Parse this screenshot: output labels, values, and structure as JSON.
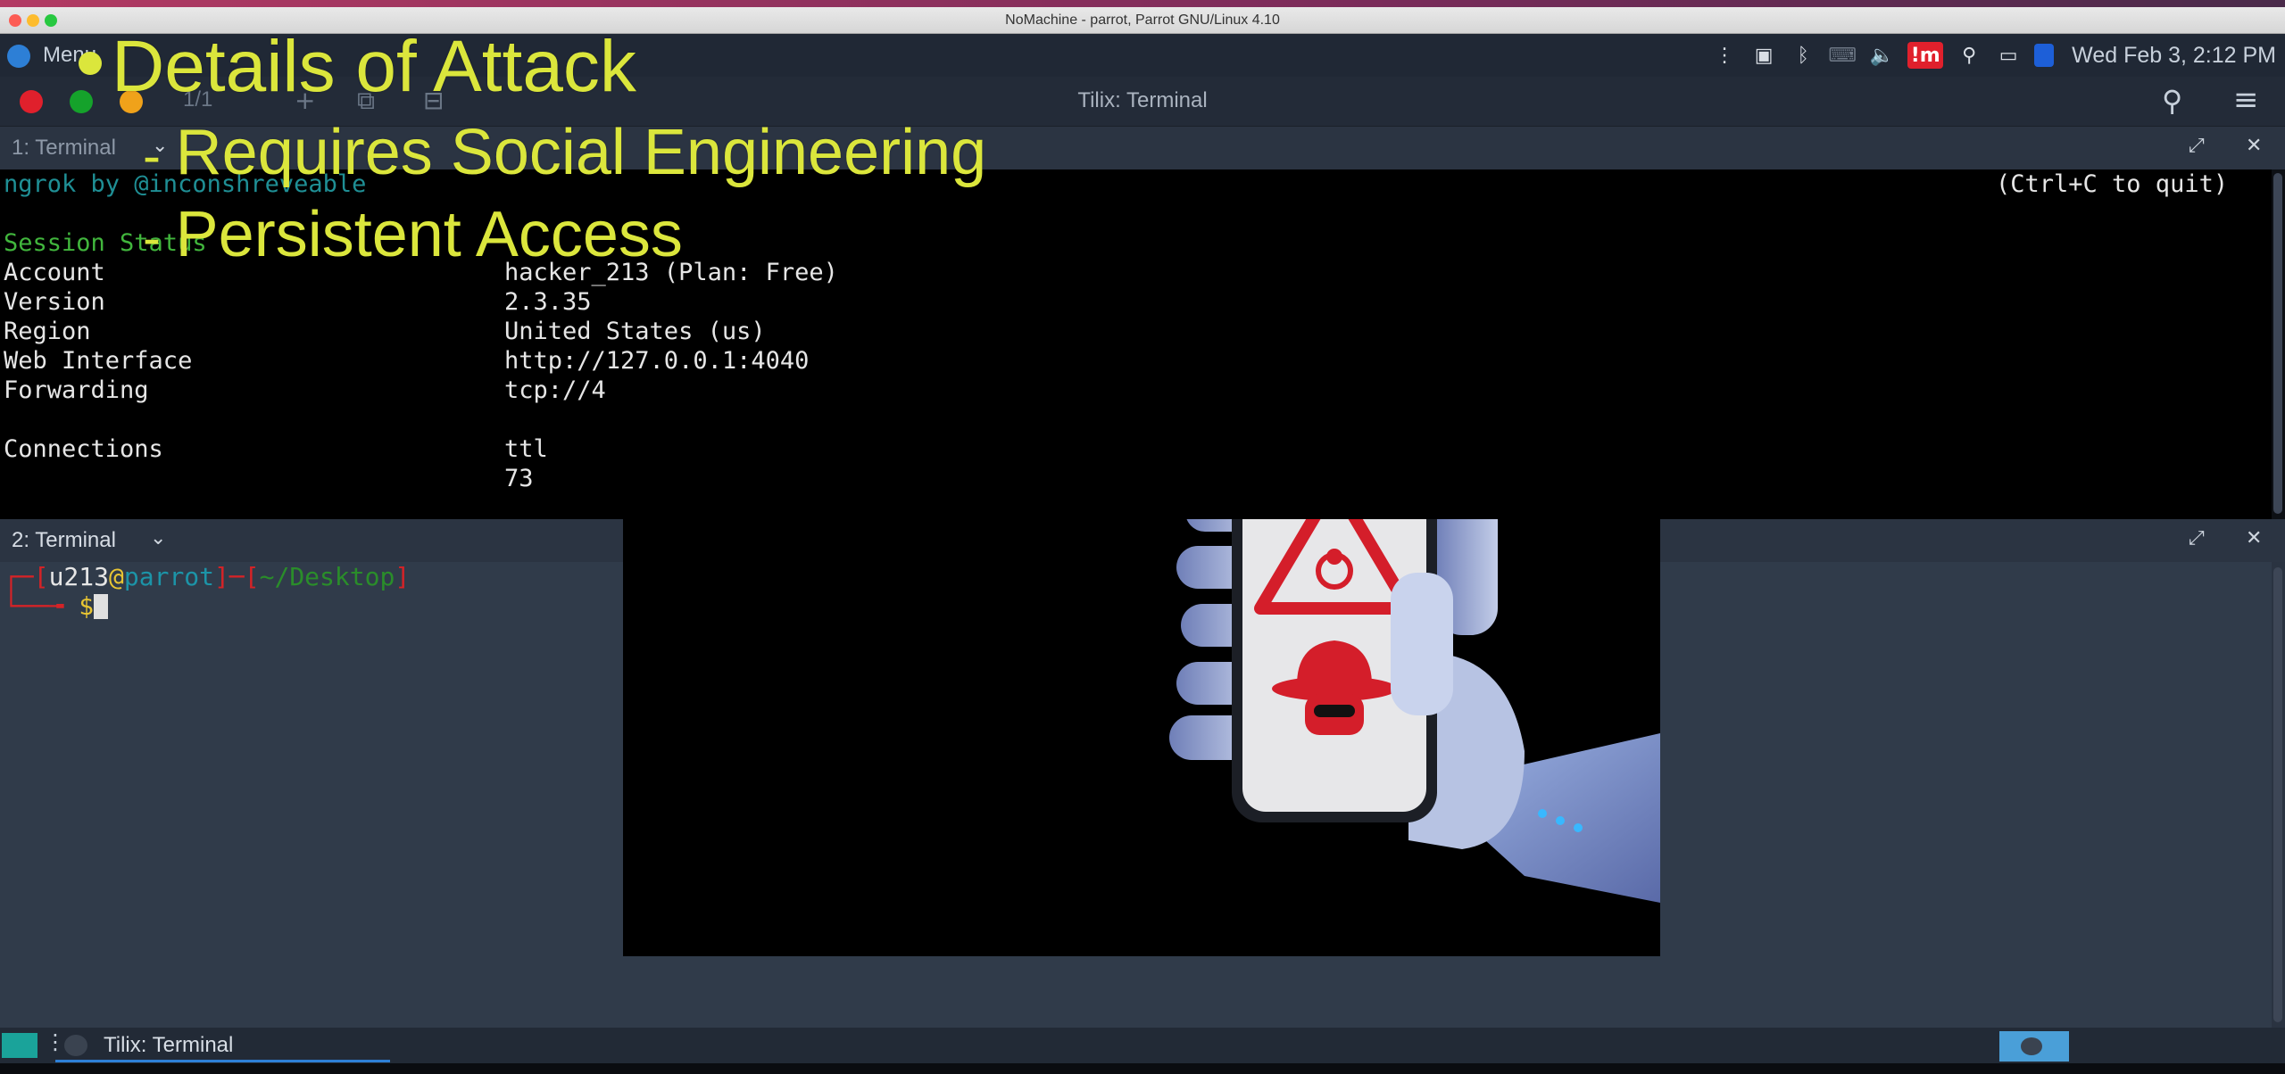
{
  "window": {
    "title": "NoMachine - parrot, Parrot GNU/Linux 4.10"
  },
  "panel": {
    "menu_label": "Menu",
    "clock": "Wed Feb 3,  2:12 PM",
    "tray_icons": [
      "more-vert-icon",
      "screenshot-icon",
      "bluetooth-icon",
      "keyboard-icon",
      "volume-icon",
      "im-icon",
      "bulb-icon",
      "display-icon",
      "shield-icon"
    ],
    "colors": {
      "accent_red": "#e0202c",
      "accent_blue": "#1d5fd8"
    }
  },
  "tilix": {
    "title": "Tilix: Terminal",
    "session_label": "1/1"
  },
  "terminal1": {
    "header_label": "1: Terminal",
    "header_line": "ngrok by @inconshreveable",
    "quit_hint": "(Ctrl+C to quit)",
    "status_heading": "Session Status",
    "rows": [
      {
        "key": "Account",
        "value": "hacker_213 (Plan: Free)"
      },
      {
        "key": "Version",
        "value": "2.3.35"
      },
      {
        "key": "Region",
        "value": "United States (us)"
      },
      {
        "key": "Web Interface",
        "value": "http://127.0.0.1:4040"
      },
      {
        "key": "Forwarding",
        "value": "tcp://4"
      }
    ],
    "connections_label": "Connections",
    "connections_header": "ttl",
    "connections_value": "73"
  },
  "terminal2": {
    "header_label": "2: Terminal",
    "prompt_user": "u213",
    "prompt_at": "@",
    "prompt_host": "parrot",
    "prompt_dir": "~/Desktop",
    "prompt_symbol": "$"
  },
  "taskbar": {
    "task_label": "Tilix: Terminal"
  },
  "slide": {
    "heading": "Details of Attack",
    "items": [
      "Requires Social Engineering",
      "Persistent Access"
    ]
  }
}
